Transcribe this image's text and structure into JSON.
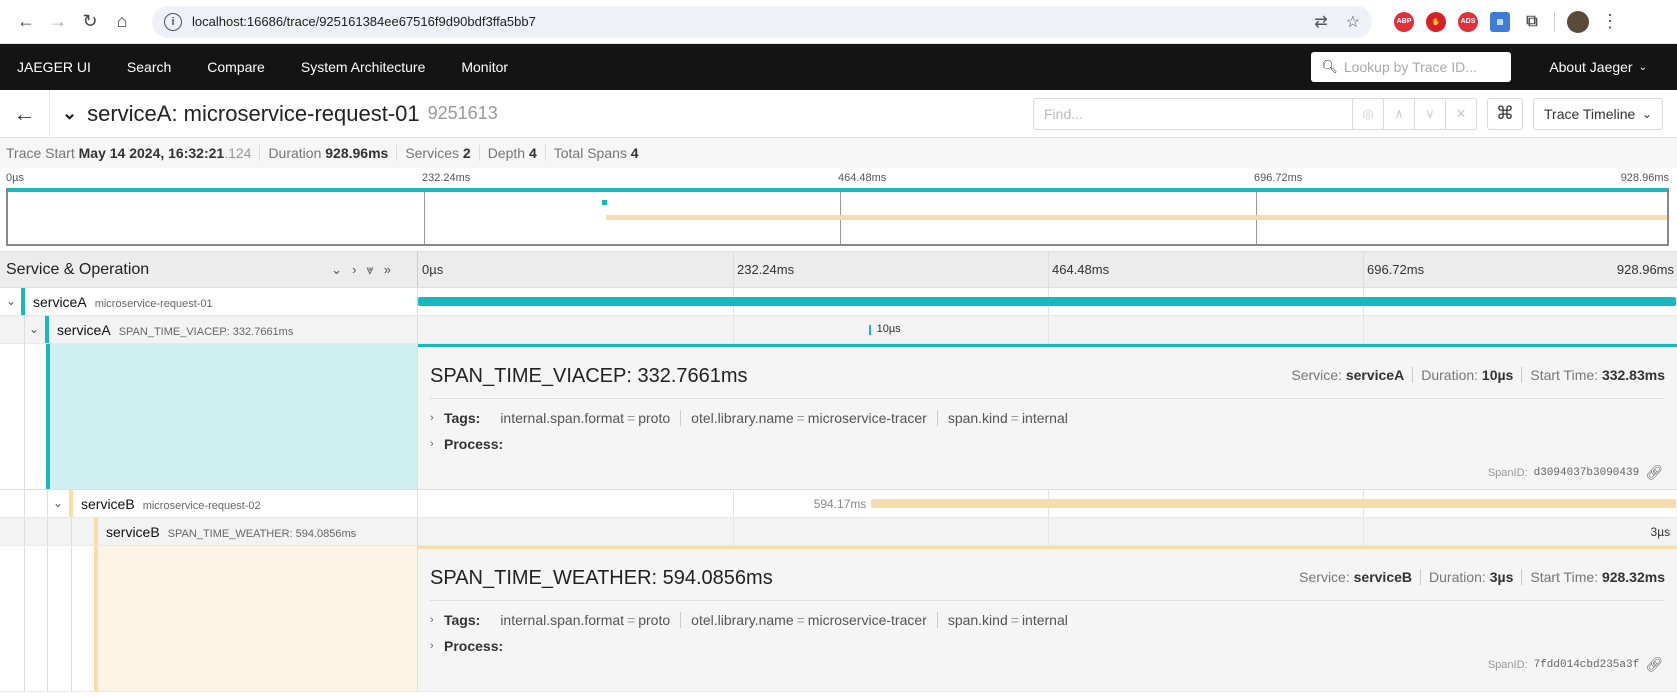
{
  "browser": {
    "url": "localhost:16686/trace/925161384ee67516f9d90bdf3ffa5bb7"
  },
  "nav": {
    "brand": "JAEGER UI",
    "items": [
      "Search",
      "Compare",
      "System Architecture",
      "Monitor"
    ],
    "lookup_placeholder": "Lookup by Trace ID...",
    "about": "About Jaeger"
  },
  "trace": {
    "title": "serviceA: microservice-request-01",
    "short_id": "9251613",
    "find_placeholder": "Find...",
    "view": "Trace Timeline"
  },
  "summary": {
    "trace_start_label": "Trace Start",
    "trace_start_value": "May 14 2024, 16:32:21",
    "trace_start_ms": ".124",
    "duration_label": "Duration",
    "duration": "928.96ms",
    "services_label": "Services",
    "services": "2",
    "depth_label": "Depth",
    "depth": "4",
    "total_spans_label": "Total Spans",
    "total_spans": "4"
  },
  "ticks": [
    "0µs",
    "232.24ms",
    "464.48ms",
    "696.72ms",
    "928.96ms"
  ],
  "timeline": {
    "header_label": "Service & Operation"
  },
  "colors": {
    "serviceA": "#17b8be",
    "serviceB": "#f8dcaa"
  },
  "spans": [
    {
      "service": "serviceA",
      "operation": "microservice-request-01",
      "start_frac": 0.0,
      "dur_frac": 1.0
    },
    {
      "service": "serviceA",
      "operation": "SPAN_TIME_VIACEP: 332.7661ms",
      "label": "10µs",
      "start_frac": 0.3582,
      "dur_frac": 0.0006
    },
    {
      "service": "serviceB",
      "operation": "microservice-request-02",
      "label": "594.17ms",
      "start_frac": 0.3604,
      "dur_frac": 0.6396
    },
    {
      "service": "serviceB",
      "operation": "SPAN_TIME_WEATHER: 594.0856ms",
      "label": "3µs",
      "start_frac": 0.9993,
      "dur_frac": 0.0007
    }
  ],
  "details": [
    {
      "title": "SPAN_TIME_VIACEP: 332.7661ms",
      "service_label": "Service:",
      "service": "serviceA",
      "duration_label": "Duration:",
      "duration": "10µs",
      "start_label": "Start Time:",
      "start": "332.83ms",
      "tags_label": "Tags:",
      "tags": [
        {
          "k": "internal.span.format",
          "v": "proto"
        },
        {
          "k": "otel.library.name",
          "v": "microservice-tracer"
        },
        {
          "k": "span.kind",
          "v": "internal"
        }
      ],
      "process_label": "Process:",
      "spanid_label": "SpanID:",
      "spanid": "d3094037b3090439"
    },
    {
      "title": "SPAN_TIME_WEATHER: 594.0856ms",
      "service_label": "Service:",
      "service": "serviceB",
      "duration_label": "Duration:",
      "duration": "3µs",
      "start_label": "Start Time:",
      "start": "928.32ms",
      "tags_label": "Tags:",
      "tags": [
        {
          "k": "internal.span.format",
          "v": "proto"
        },
        {
          "k": "otel.library.name",
          "v": "microservice-tracer"
        },
        {
          "k": "span.kind",
          "v": "internal"
        }
      ],
      "process_label": "Process:",
      "spanid_label": "SpanID:",
      "spanid": "7fdd014cbd235a3f"
    }
  ]
}
